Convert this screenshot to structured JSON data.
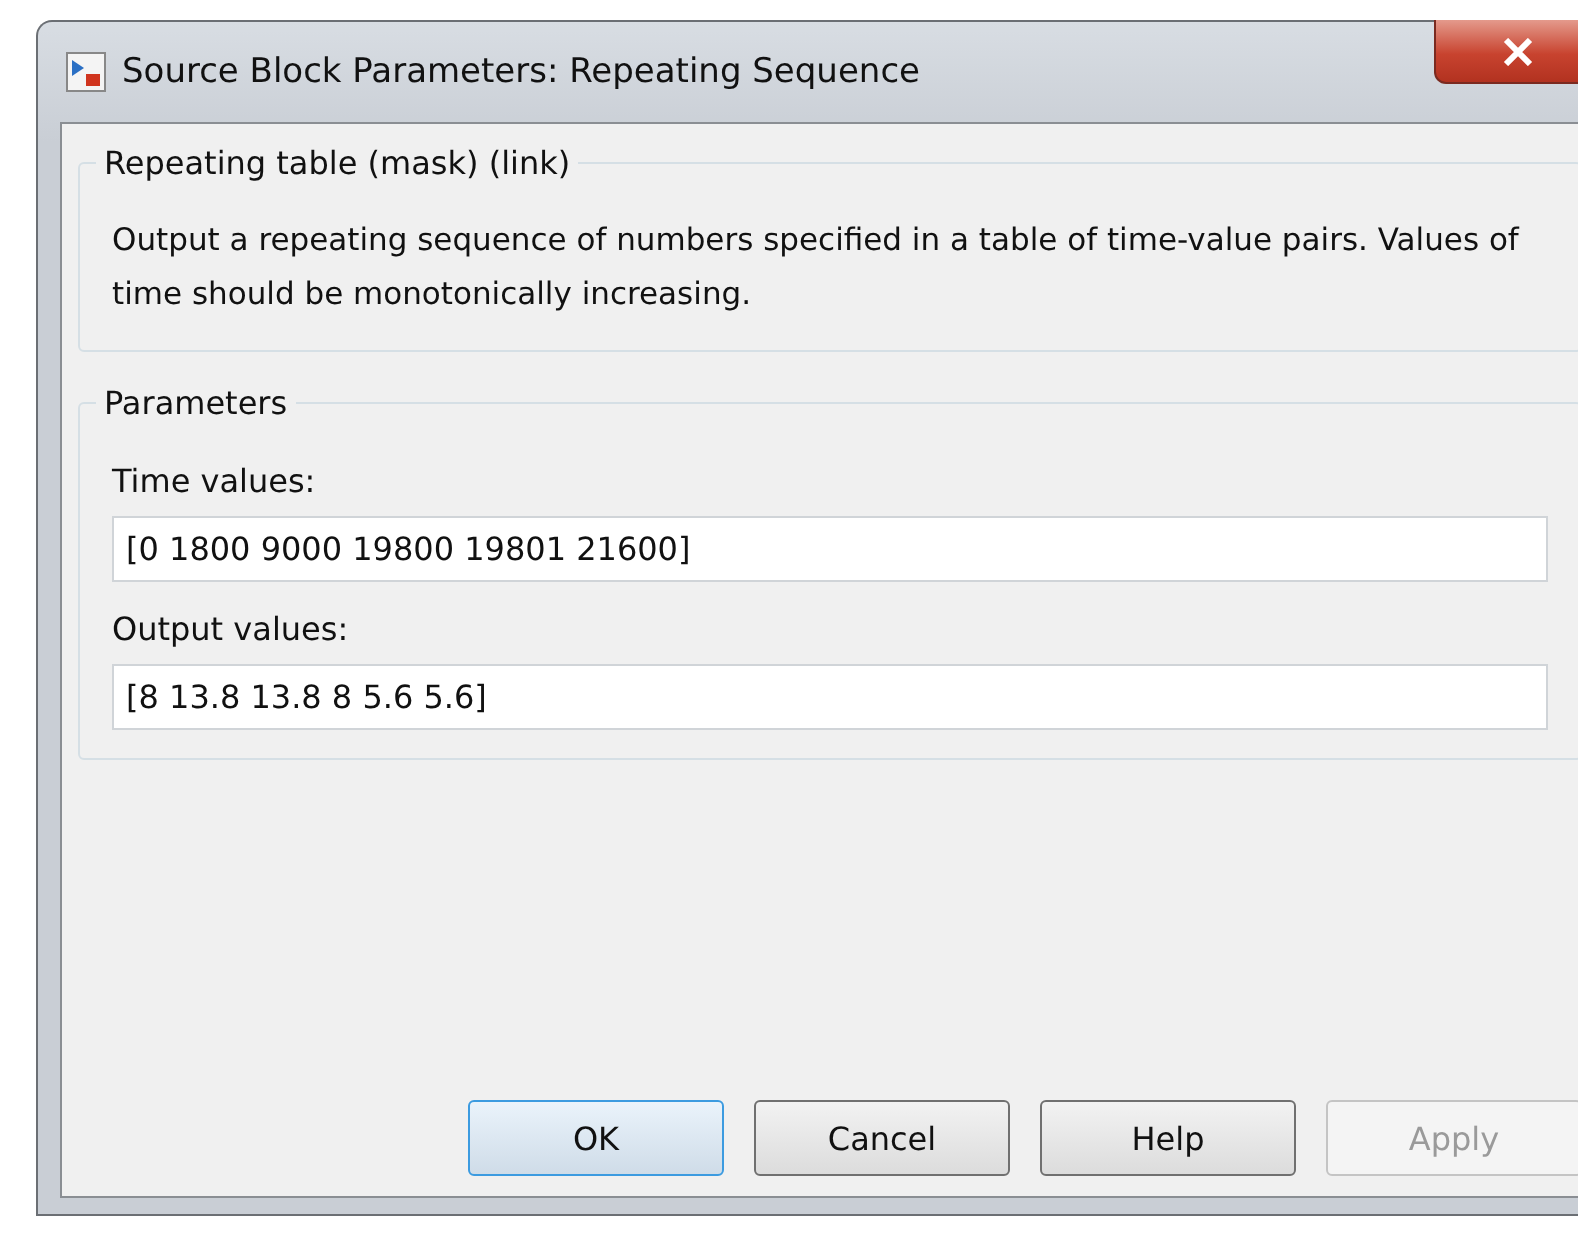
{
  "window": {
    "title": "Source Block Parameters: Repeating Sequence"
  },
  "description_group": {
    "title": "Repeating table (mask) (link)",
    "text": "Output a repeating sequence of numbers specified in a table of time-value pairs. Values of time should be monotonically increasing."
  },
  "parameters": {
    "title": "Parameters",
    "fields": [
      {
        "label": "Time values:",
        "value": "[0 1800 9000 19800 19801 21600]"
      },
      {
        "label": "Output values:",
        "value": "[8 13.8 13.8 8 5.6 5.6]"
      }
    ]
  },
  "buttons": [
    {
      "label": "OK",
      "default": true,
      "disabled": false
    },
    {
      "label": "Cancel",
      "default": false,
      "disabled": false
    },
    {
      "label": "Help",
      "default": false,
      "disabled": false
    },
    {
      "label": "Apply",
      "default": false,
      "disabled": true
    }
  ]
}
